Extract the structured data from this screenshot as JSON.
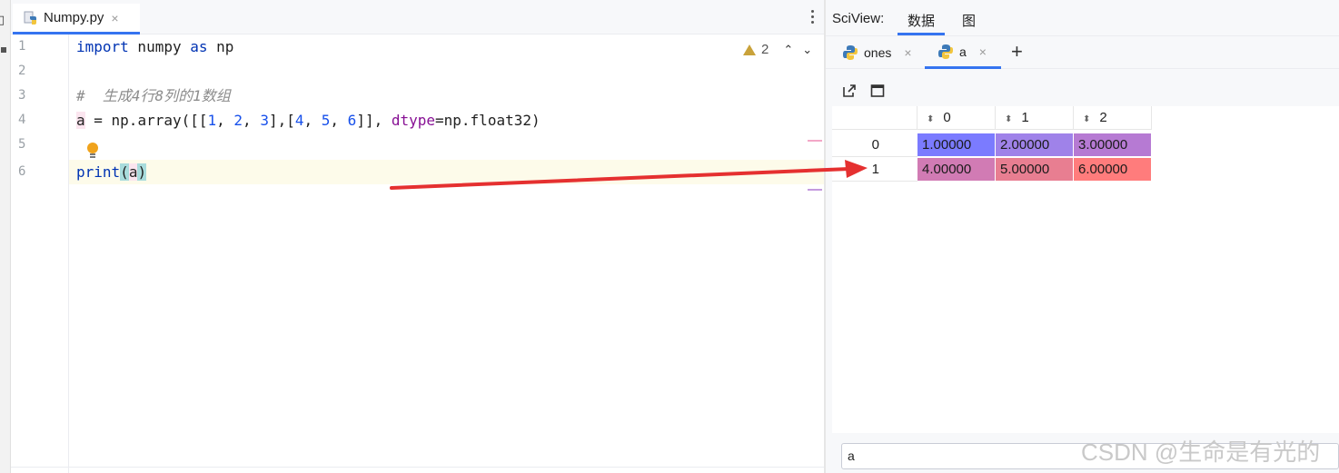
{
  "editor": {
    "tab": {
      "filename": "Numpy.py",
      "close": "×"
    },
    "line_numbers": [
      "1",
      "2",
      "3",
      "4",
      "5",
      "6"
    ],
    "code": {
      "l1_kw_import": "import",
      "l1_mod": " numpy ",
      "l1_kw_as": "as",
      "l1_alias": " np",
      "l3_comment": "#  生成4行8列的1数组",
      "l4_var": "a",
      "l4_eq": " = np.array([[",
      "l4_n1": "1",
      "l4_s1": ", ",
      "l4_n2": "2",
      "l4_s2": ", ",
      "l4_n3": "3",
      "l4_s3": "],[",
      "l4_n4": "4",
      "l4_s4": ", ",
      "l4_n5": "5",
      "l4_s5": ", ",
      "l4_n6": "6",
      "l4_s6": "]], ",
      "l4_named": "dtype",
      "l4_tail": "=np.float32)",
      "l6_print": "print",
      "l6_open": "(",
      "l6_arg": "a",
      "l6_close": ")"
    },
    "inspections": {
      "warning_count": "2",
      "nav": "⌃⌄"
    }
  },
  "sciview": {
    "title": "SciView:",
    "tabs": [
      "数据",
      "图"
    ],
    "var_tabs": [
      {
        "name": "ones",
        "close": "×"
      },
      {
        "name": "a",
        "close": "×"
      }
    ],
    "add": "+",
    "table": {
      "columns": [
        "0",
        "1",
        "2"
      ],
      "rows": [
        {
          "index": "0",
          "cells": [
            "1.00000",
            "2.00000",
            "3.00000"
          ]
        },
        {
          "index": "1",
          "cells": [
            "4.00000",
            "5.00000",
            "6.00000"
          ]
        }
      ]
    },
    "cell_colors": [
      "#7b7bff",
      "#9f82e9",
      "#b67ad3",
      "#d17bb4",
      "#e87e91",
      "#ff7c7c"
    ],
    "filter_value": "a"
  },
  "watermark": "CSDN @生命是有光的",
  "accent_color": "#3574f0",
  "annotation_arrow_color": "#e53030",
  "icons": [
    "python-file-icon",
    "close-icon",
    "more-icon",
    "warning-icon",
    "lightbulb-icon",
    "open-in-editor-icon",
    "window-icon",
    "sort-icon",
    "plus-icon"
  ]
}
